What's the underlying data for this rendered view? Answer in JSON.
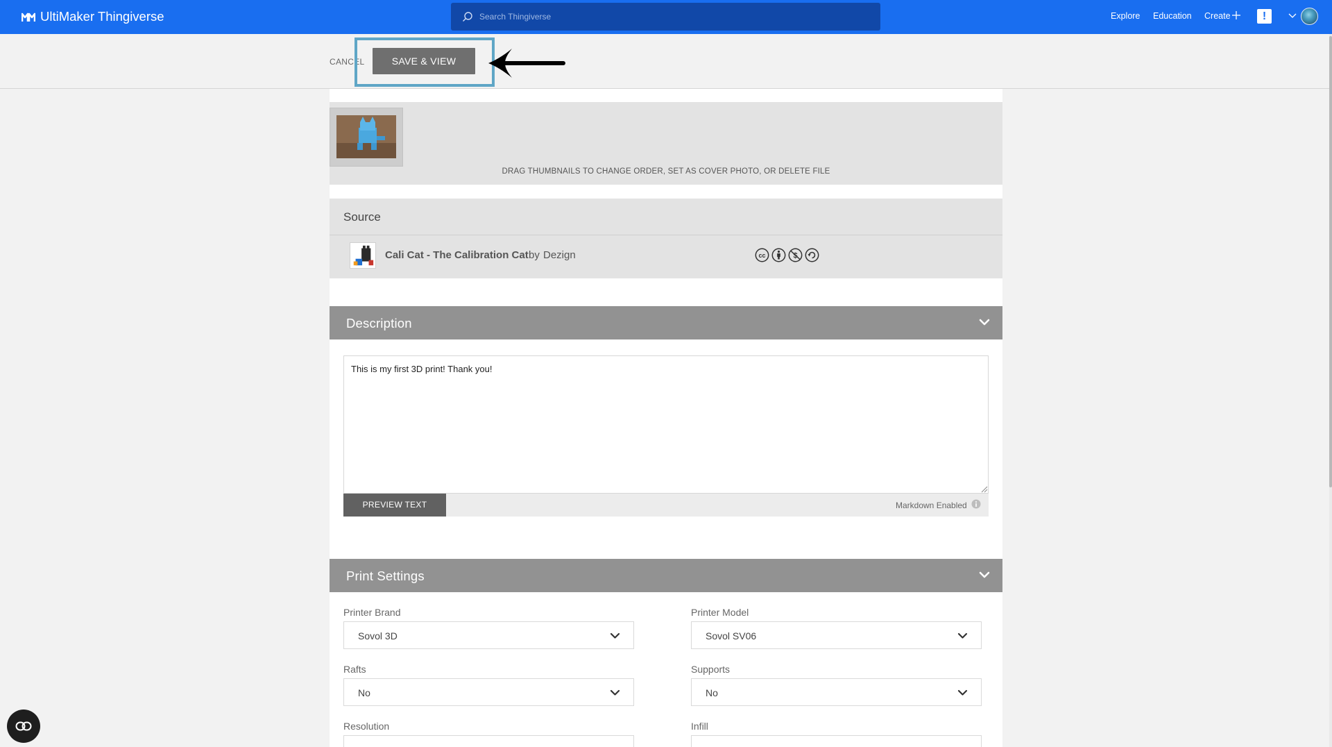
{
  "header": {
    "brand": "UltiMaker Thingiverse",
    "search_placeholder": "Search Thingiverse",
    "nav": {
      "explore": "Explore",
      "education": "Education",
      "create": "Create"
    },
    "alert": "!"
  },
  "actions": {
    "cancel": "CANCEL",
    "save_view": "SAVE & VIEW"
  },
  "thumbnails": {
    "hint": "DRAG THUMBNAILS TO CHANGE ORDER, SET AS COVER PHOTO, OR DELETE FILE"
  },
  "source": {
    "title": "Source",
    "thing_name": "Cali Cat - The Calibration Cat",
    "by": "by",
    "author": "Dezign",
    "license_icons": [
      "cc-icon",
      "attribution-icon",
      "noncommercial-icon",
      "sharealike-icon"
    ]
  },
  "description": {
    "title": "Description",
    "text": "This is my first 3D print! Thank you!",
    "preview_label": "PREVIEW TEXT",
    "markdown_label": "Markdown Enabled"
  },
  "print_settings": {
    "title": "Print Settings",
    "printer_brand": {
      "label": "Printer Brand",
      "value": "Sovol 3D"
    },
    "printer_model": {
      "label": "Printer Model",
      "value": "Sovol SV06"
    },
    "rafts": {
      "label": "Rafts",
      "value": "No"
    },
    "supports": {
      "label": "Supports",
      "value": "No"
    },
    "resolution": {
      "label": "Resolution",
      "value": ""
    },
    "infill": {
      "label": "Infill",
      "value": ""
    }
  },
  "colors": {
    "brand_blue": "#196ef0",
    "search_bg": "#1148a8",
    "section_header": "#929292",
    "highlight": "#5fa6c6"
  }
}
